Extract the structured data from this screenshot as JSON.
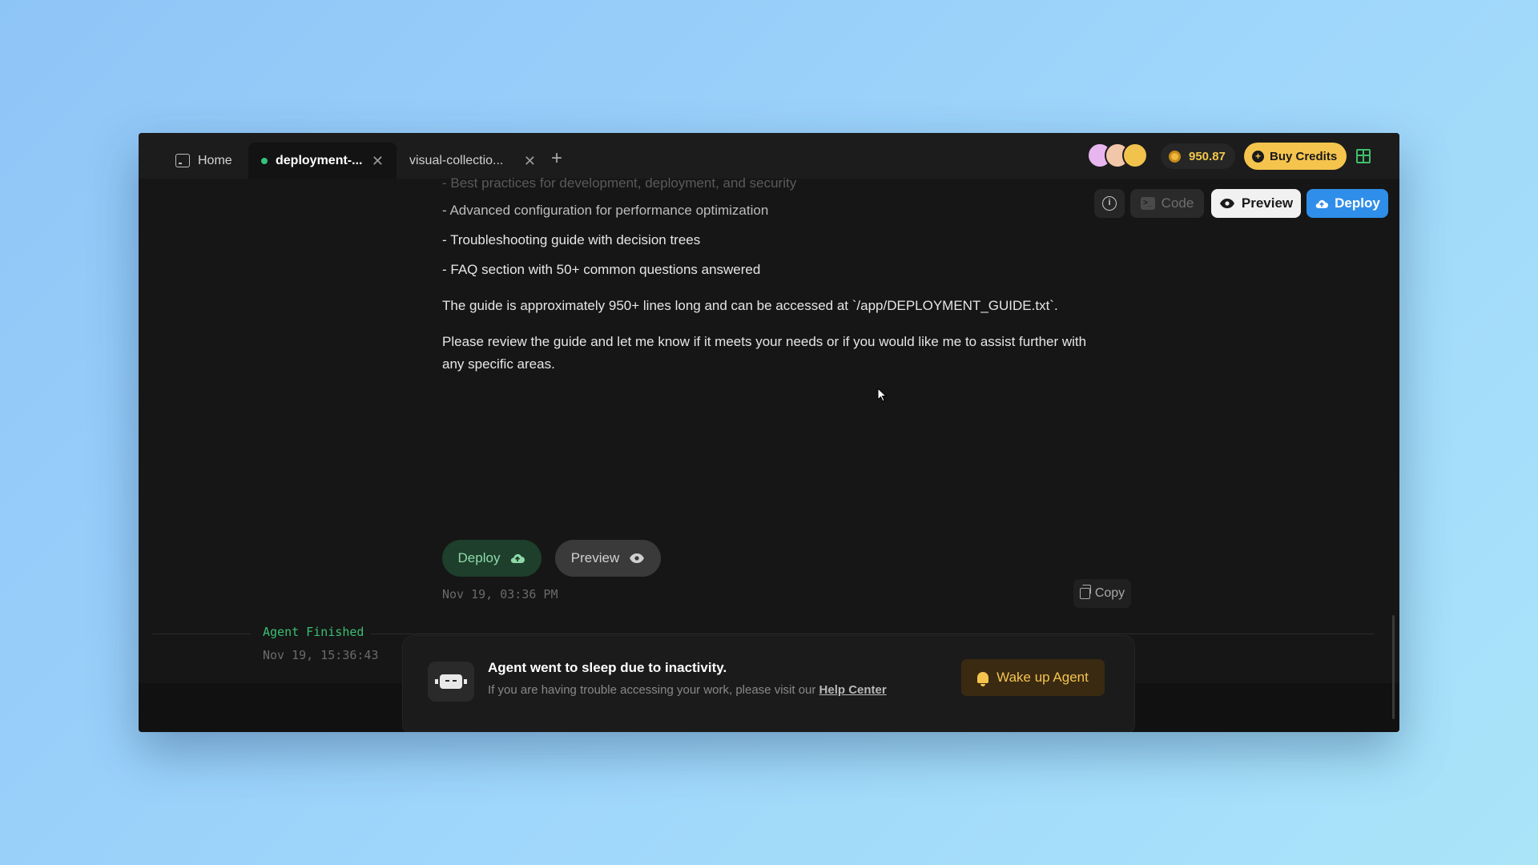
{
  "tabs": {
    "home_label": "Home",
    "active_label": "deployment-...",
    "other_label": "visual-collectio...",
    "new_tab": "+"
  },
  "header": {
    "credits": "950.87",
    "buy_credits_label": "Buy Credits",
    "avatar_colors": [
      "#e7b6ef",
      "#f2c6a8",
      "#f1c24c"
    ]
  },
  "toolbar": {
    "code_label": "Code",
    "preview_label": "Preview",
    "deploy_label": "Deploy"
  },
  "message": {
    "faded_line": "- Best practices for development, deployment, and security",
    "bullets": [
      "- Advanced configuration for performance optimization",
      "- Troubleshooting guide with decision trees",
      "- FAQ section with 50+ common questions answered"
    ],
    "para1": "The guide is approximately 950+ lines long and can be accessed at `/app/DEPLOYMENT_GUIDE.txt`.",
    "para2_line1": "Please review the guide and let me know if it meets your needs or if you would like me to assist further with",
    "para2_line2": "any specific areas.",
    "deploy_label": "Deploy",
    "preview_label": "Preview",
    "timestamp": "Nov 19, 03:36 PM",
    "copy_label": "Copy"
  },
  "agent": {
    "status": "Agent Finished",
    "timestamp": "Nov 19, 15:36:43"
  },
  "sleep_banner": {
    "title": "Agent went to sleep due to inactivity.",
    "subtitle": "If you are having trouble accessing your work, please visit our",
    "help_link": "Help Center",
    "wake_label": "Wake up Agent"
  },
  "colors": {
    "accent_blue": "#2f8ee9",
    "accent_green": "#3bbf73",
    "accent_gold": "#f5c44d",
    "window_bg": "#161616"
  }
}
